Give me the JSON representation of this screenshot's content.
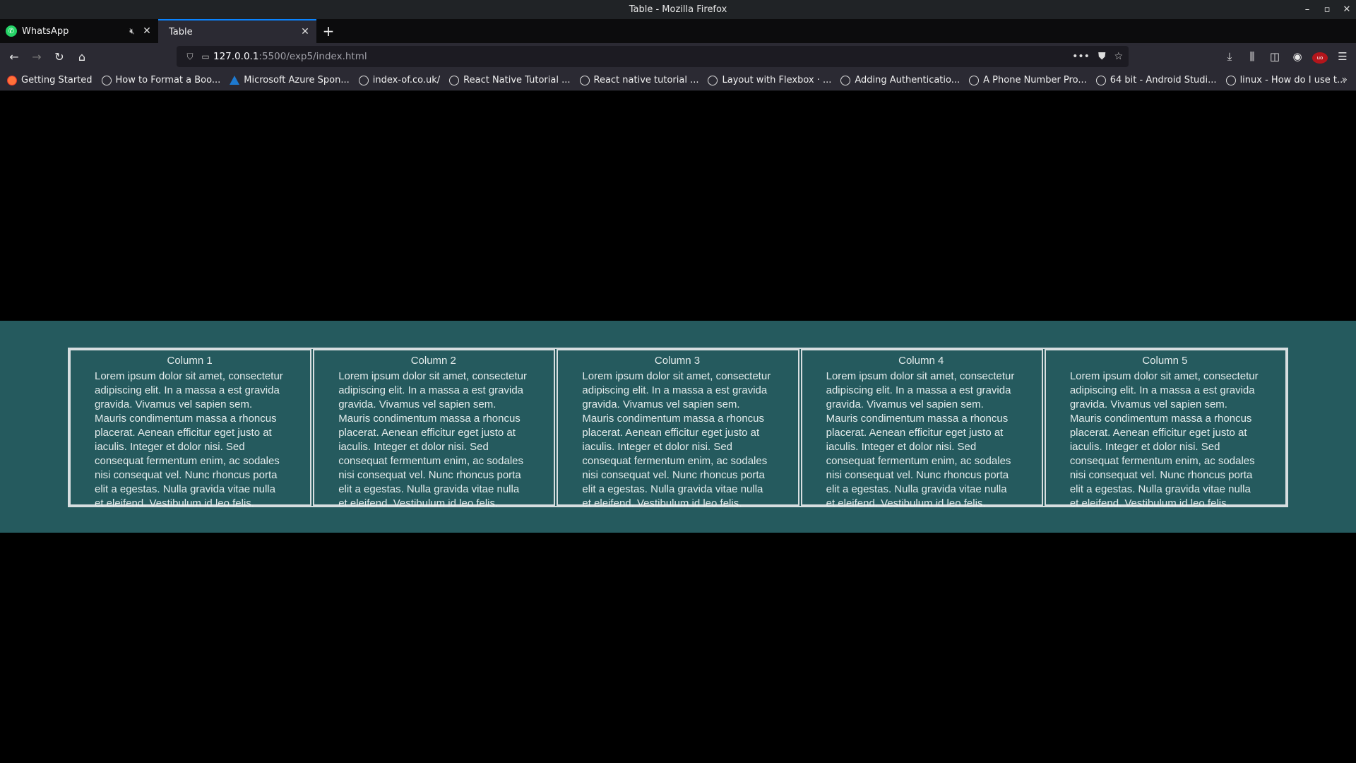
{
  "window": {
    "title": "Table - Mozilla Firefox",
    "controls": [
      "–",
      "▫",
      "✕"
    ]
  },
  "tabs": [
    {
      "label": "WhatsApp",
      "icon": "whatsapp-icon",
      "active": false
    },
    {
      "label": "Table",
      "active": true
    }
  ],
  "new_tab_label": "+",
  "navbar": {
    "url_host": "127.0.0.1",
    "url_path": ":5500/exp5/index.html"
  },
  "bookmarks": [
    {
      "label": "Getting Started",
      "icon": "firefox-icon"
    },
    {
      "label": "How to Format a Boo...",
      "icon": "globe-icon"
    },
    {
      "label": "Microsoft Azure Spon...",
      "icon": "azure-icon"
    },
    {
      "label": "index-of.co.uk/",
      "icon": "globe-icon"
    },
    {
      "label": "React Native Tutorial ...",
      "icon": "globe-icon"
    },
    {
      "label": "React native tutorial ...",
      "icon": "globe-icon"
    },
    {
      "label": "Layout with Flexbox · ...",
      "icon": "globe-icon"
    },
    {
      "label": "Adding Authenticatio...",
      "icon": "globe-icon"
    },
    {
      "label": "A Phone Number Pro...",
      "icon": "globe-icon"
    },
    {
      "label": "64 bit - Android Studi...",
      "icon": "globe-icon"
    },
    {
      "label": "linux - How do I use t...",
      "icon": "globe-icon"
    }
  ],
  "colors": {
    "band": "#255a5e",
    "border": "#d7dee0",
    "accent": "#0a84ff"
  },
  "table": {
    "columns": [
      {
        "header": "Column 1",
        "body": "Lorem ipsum dolor sit amet, consectetur adipiscing elit. In a massa a est gravida gravida. Vivamus vel sapien sem. Mauris condimentum massa a rhoncus placerat. Aenean efficitur eget justo at iaculis. Integer et dolor nisi. Sed consequat fermentum enim, ac sodales nisi consequat vel. Nunc rhoncus porta elit a egestas. Nulla gravida vitae nulla et eleifend. Vestibulum id leo felis."
      },
      {
        "header": "Column 2",
        "body": "Lorem ipsum dolor sit amet, consectetur adipiscing elit. In a massa a est gravida gravida. Vivamus vel sapien sem. Mauris condimentum massa a rhoncus placerat. Aenean efficitur eget justo at iaculis. Integer et dolor nisi. Sed consequat fermentum enim, ac sodales nisi consequat vel. Nunc rhoncus porta elit a egestas. Nulla gravida vitae nulla et eleifend. Vestibulum id leo felis."
      },
      {
        "header": "Column 3",
        "body": "Lorem ipsum dolor sit amet, consectetur adipiscing elit. In a massa a est gravida gravida. Vivamus vel sapien sem. Mauris condimentum massa a rhoncus placerat. Aenean efficitur eget justo at iaculis. Integer et dolor nisi. Sed consequat fermentum enim, ac sodales nisi consequat vel. Nunc rhoncus porta elit a egestas. Nulla gravida vitae nulla et eleifend. Vestibulum id leo felis."
      },
      {
        "header": "Column 4",
        "body": "Lorem ipsum dolor sit amet, consectetur adipiscing elit. In a massa a est gravida gravida. Vivamus vel sapien sem. Mauris condimentum massa a rhoncus placerat. Aenean efficitur eget justo at iaculis. Integer et dolor nisi. Sed consequat fermentum enim, ac sodales nisi consequat vel. Nunc rhoncus porta elit a egestas. Nulla gravida vitae nulla et eleifend. Vestibulum id leo felis."
      },
      {
        "header": "Column 5",
        "body": "Lorem ipsum dolor sit amet, consectetur adipiscing elit. In a massa a est gravida gravida. Vivamus vel sapien sem. Mauris condimentum massa a rhoncus placerat. Aenean efficitur eget justo at iaculis. Integer et dolor nisi. Sed consequat fermentum enim, ac sodales nisi consequat vel. Nunc rhoncus porta elit a egestas. Nulla gravida vitae nulla et eleifend. Vestibulum id leo felis."
      }
    ]
  }
}
